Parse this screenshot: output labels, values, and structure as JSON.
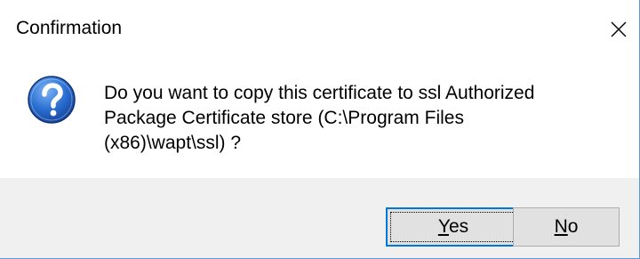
{
  "window": {
    "title": "Confirmation",
    "close_icon": "close-icon"
  },
  "message": {
    "icon": "question-icon",
    "text": "Do you want to copy this certificate to ssl Authorized\nPackage Certificate store (C:\\Program Files\n(x86)\\wapt\\ssl) ?"
  },
  "buttons": {
    "yes": {
      "mnemonic": "Y",
      "rest": "es"
    },
    "no": {
      "mnemonic": "N",
      "rest": "o"
    }
  },
  "colors": {
    "accent": "#0078d7",
    "icon_blue": "#1d5bb8",
    "footer_bg": "#f0f0f0",
    "button_bg": "#e1e1e1"
  }
}
